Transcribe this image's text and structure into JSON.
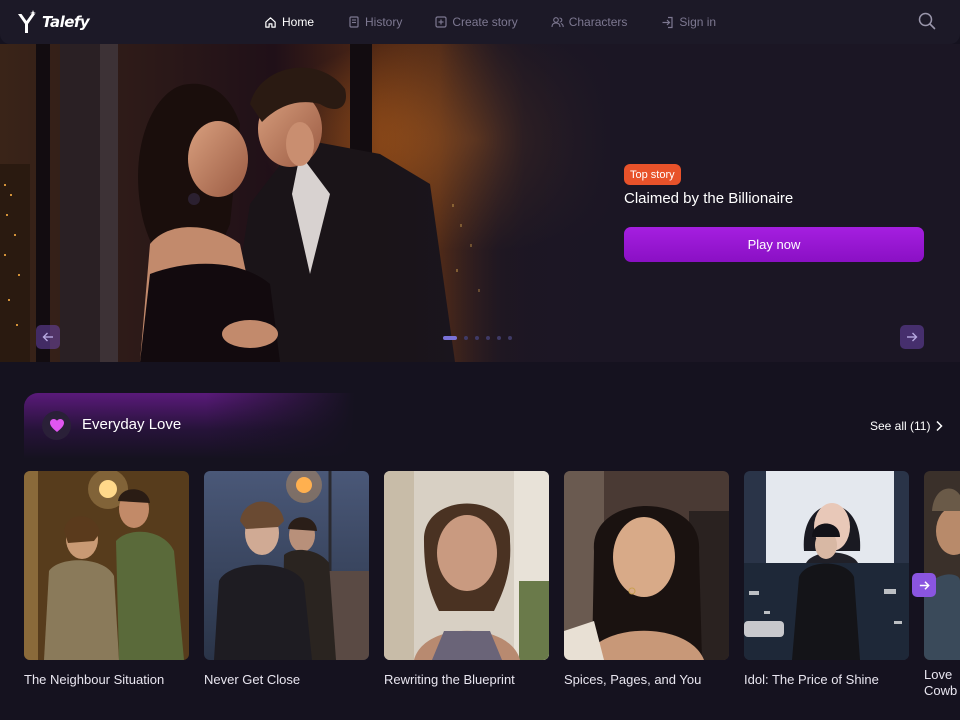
{
  "brand": {
    "name": "Talefy"
  },
  "nav": {
    "items": [
      {
        "label": "Home",
        "icon": "home-icon",
        "active": true
      },
      {
        "label": "History",
        "icon": "history-icon",
        "active": false
      },
      {
        "label": "Create story",
        "icon": "plus-square-icon",
        "active": false
      },
      {
        "label": "Characters",
        "icon": "users-icon",
        "active": false
      },
      {
        "label": "Sign in",
        "icon": "sign-in-icon",
        "active": false
      }
    ],
    "search_icon": "search-icon"
  },
  "hero": {
    "badge": "Top story",
    "title": "Claimed by the Billionaire",
    "cta": "Play now",
    "slide_count": 6,
    "active_slide": 1
  },
  "section": {
    "title": "Everyday Love",
    "icon": "heart-icon",
    "see_all": "See all (11)",
    "cards": [
      {
        "title": "The Neighbour Situation"
      },
      {
        "title": "Never Get Close"
      },
      {
        "title": "Rewriting the Blueprint"
      },
      {
        "title": "Spices, Pages, and You"
      },
      {
        "title": "Idol: The Price of Shine"
      },
      {
        "title": "Love Cowb"
      }
    ]
  },
  "colors": {
    "background": "#15121f",
    "topbar": "#1c1927",
    "accent_purple": "#a51fe0",
    "badge_orange": "#e8522a",
    "heart_pink": "#e056f0",
    "nav_inactive": "#7d7891"
  }
}
